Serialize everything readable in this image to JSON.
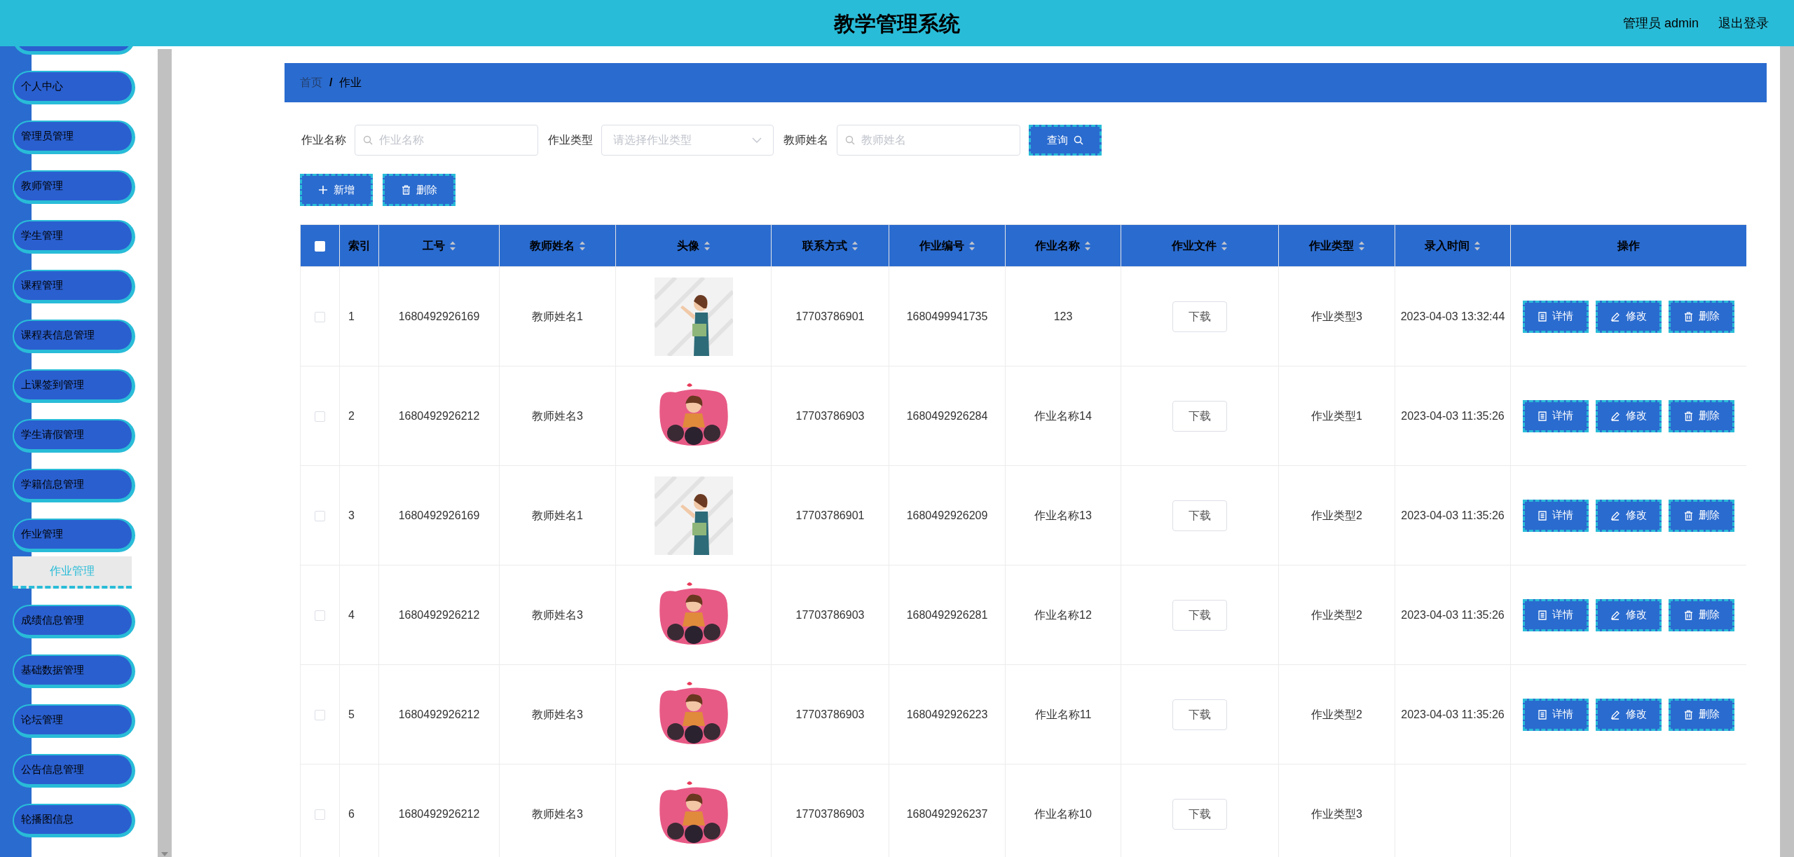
{
  "header": {
    "title": "教学管理系统",
    "user": "管理员 admin",
    "logout": "退出登录"
  },
  "sidebar": {
    "items": [
      {
        "label": "个人中心"
      },
      {
        "label": "管理员管理"
      },
      {
        "label": "教师管理"
      },
      {
        "label": "学生管理"
      },
      {
        "label": "课程管理"
      },
      {
        "label": "课程表信息管理"
      },
      {
        "label": "上课签到管理"
      },
      {
        "label": "学生请假管理"
      },
      {
        "label": "学籍信息管理"
      },
      {
        "label": "作业管理",
        "children": [
          {
            "label": "作业管理",
            "selected": true
          }
        ]
      },
      {
        "label": "成绩信息管理"
      },
      {
        "label": "基础数据管理"
      },
      {
        "label": "论坛管理"
      },
      {
        "label": "公告信息管理"
      },
      {
        "label": "轮播图信息"
      }
    ]
  },
  "breadcrumb": {
    "items": [
      "首页",
      "作业"
    ],
    "separator": "/"
  },
  "filters": [
    {
      "kind": "search",
      "label": "作业名称",
      "placeholder": "作业名称"
    },
    {
      "kind": "select",
      "label": "作业类型",
      "placeholder": "请选择作业类型"
    },
    {
      "kind": "search",
      "label": "教师姓名",
      "placeholder": "教师姓名"
    }
  ],
  "query_button": "查询",
  "toolbar": [
    {
      "kind": "add",
      "label": "新增"
    },
    {
      "kind": "delete",
      "label": "删除"
    }
  ],
  "table": {
    "select_all": {
      "checked": false
    },
    "columns": [
      {
        "label": "索引",
        "sortable": false
      },
      {
        "label": "工号",
        "sortable": true
      },
      {
        "label": "教师姓名",
        "sortable": true
      },
      {
        "label": "头像",
        "sortable": true
      },
      {
        "label": "联系方式",
        "sortable": true
      },
      {
        "label": "作业编号",
        "sortable": true
      },
      {
        "label": "作业名称",
        "sortable": true
      },
      {
        "label": "作业文件",
        "sortable": true
      },
      {
        "label": "作业类型",
        "sortable": true
      },
      {
        "label": "录入时间",
        "sortable": true
      },
      {
        "label": "操作",
        "sortable": false
      }
    ],
    "rows": [
      {
        "checked": false,
        "index": "1",
        "staff_no": "1680492926169",
        "teacher": "教师姓名1",
        "phone": "17703786901",
        "hw_no": "1680499941735",
        "hw_name": "123",
        "file": "下载",
        "type": "作业类型3",
        "time": "2023-04-03 13:32:44",
        "actions": [
          {
            "kind": "detail",
            "label": "详情"
          },
          {
            "kind": "edit",
            "label": "修改"
          },
          {
            "kind": "delete",
            "label": "删除"
          }
        ]
      },
      {
        "checked": false,
        "index": "2",
        "staff_no": "1680492926212",
        "teacher": "教师姓名3",
        "phone": "17703786903",
        "hw_no": "1680492926284",
        "hw_name": "作业名称14",
        "file": "下载",
        "type": "作业类型1",
        "time": "2023-04-03 11:35:26",
        "actions": [
          {
            "kind": "detail",
            "label": "详情"
          },
          {
            "kind": "edit",
            "label": "修改"
          },
          {
            "kind": "delete",
            "label": "删除"
          }
        ]
      },
      {
        "checked": false,
        "index": "3",
        "staff_no": "1680492926169",
        "teacher": "教师姓名1",
        "phone": "17703786901",
        "hw_no": "1680492926209",
        "hw_name": "作业名称13",
        "file": "下载",
        "type": "作业类型2",
        "time": "2023-04-03 11:35:26",
        "actions": [
          {
            "kind": "detail",
            "label": "详情"
          },
          {
            "kind": "edit",
            "label": "修改"
          },
          {
            "kind": "delete",
            "label": "删除"
          }
        ]
      },
      {
        "checked": false,
        "index": "4",
        "staff_no": "1680492926212",
        "teacher": "教师姓名3",
        "phone": "17703786903",
        "hw_no": "1680492926281",
        "hw_name": "作业名称12",
        "file": "下载",
        "type": "作业类型2",
        "time": "2023-04-03 11:35:26",
        "actions": [
          {
            "kind": "detail",
            "label": "详情"
          },
          {
            "kind": "edit",
            "label": "修改"
          },
          {
            "kind": "delete",
            "label": "删除"
          }
        ]
      },
      {
        "checked": false,
        "index": "5",
        "staff_no": "1680492926212",
        "teacher": "教师姓名3",
        "phone": "17703786903",
        "hw_no": "1680492926223",
        "hw_name": "作业名称11",
        "file": "下载",
        "type": "作业类型2",
        "time": "2023-04-03 11:35:26",
        "actions": [
          {
            "kind": "detail",
            "label": "详情"
          },
          {
            "kind": "edit",
            "label": "修改"
          },
          {
            "kind": "delete",
            "label": "删除"
          }
        ]
      },
      {
        "checked": false,
        "index": "6",
        "staff_no": "1680492926212",
        "teacher": "教师姓名3",
        "phone": "17703786903",
        "hw_no": "1680492926237",
        "hw_name": "作业名称10",
        "file": "下载",
        "type": "作业类型3"
      }
    ]
  }
}
